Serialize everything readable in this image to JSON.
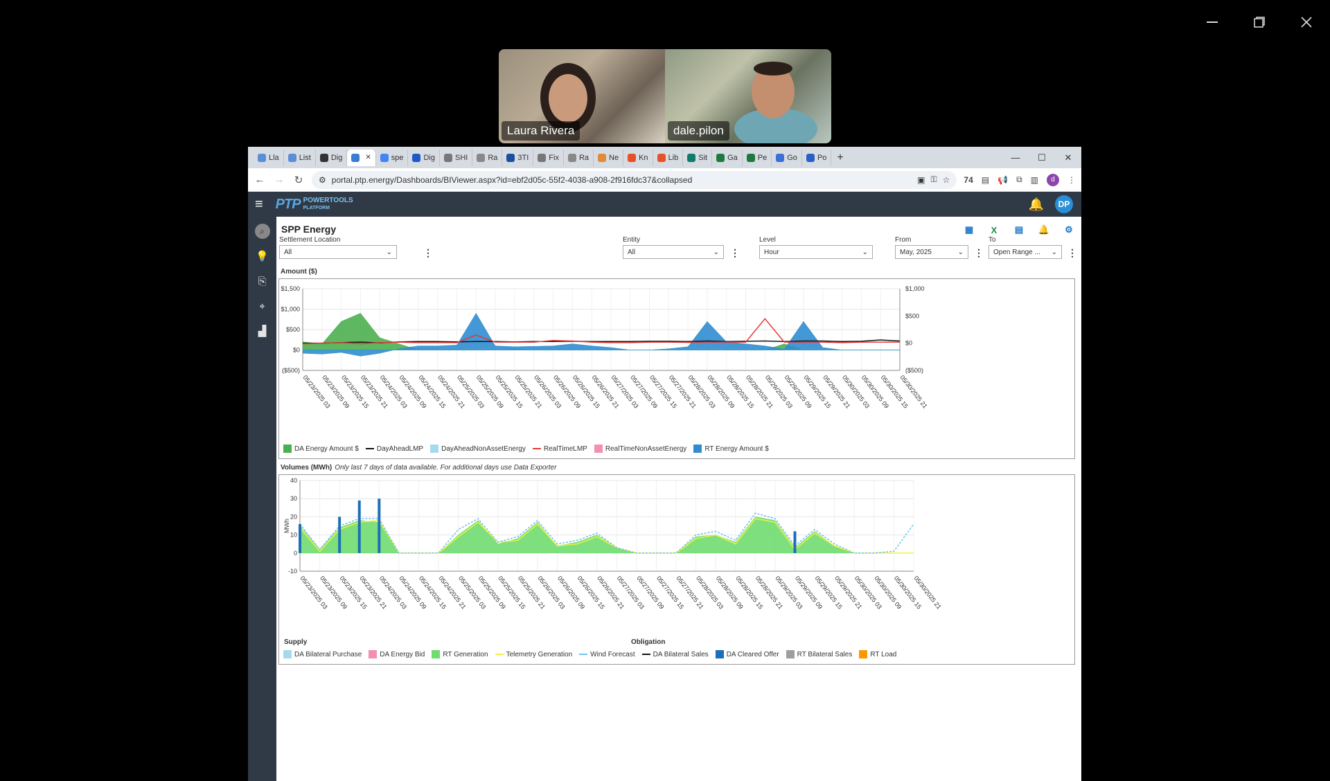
{
  "meeting": {
    "participants": [
      {
        "name": "Laura Rivera"
      },
      {
        "name": "dale.pilon"
      }
    ]
  },
  "browser": {
    "tabs": [
      {
        "label": "Lla",
        "color": "#5a8fd8"
      },
      {
        "label": "List",
        "color": "#5a8fd8"
      },
      {
        "label": "Dig",
        "color": "#333"
      },
      {
        "label": "",
        "color": "#3a7bd5"
      },
      {
        "label": "spe",
        "color": "#4285f4"
      },
      {
        "label": "Dig",
        "color": "#1f57c8"
      },
      {
        "label": "SHI",
        "color": "#777"
      },
      {
        "label": "Ra",
        "color": "#888"
      },
      {
        "label": "3TI",
        "color": "#1a4fa0"
      },
      {
        "label": "Fix",
        "color": "#777"
      },
      {
        "label": "Ra",
        "color": "#888"
      },
      {
        "label": "Ne",
        "color": "#e08a3a"
      },
      {
        "label": "Kn",
        "color": "#e8502a"
      },
      {
        "label": "Lib",
        "color": "#e8502a"
      },
      {
        "label": "Sit",
        "color": "#0f7b6c"
      },
      {
        "label": "Ga",
        "color": "#1d7a3e"
      },
      {
        "label": "Pe",
        "color": "#1d7a3e"
      },
      {
        "label": "Go",
        "color": "#3a6fd8"
      },
      {
        "label": "Po",
        "color": "#2a5fc8"
      }
    ],
    "active_tab_index": 3,
    "url": "portal.ptp.energy/Dashboards/BIViewer.aspx?id=ebf2d05c-55f2-4038-a908-2f916fdc37&collapsed",
    "badge_count": "74",
    "profile_initial": "d"
  },
  "app": {
    "logo_text": "PTP",
    "logo_sub": "POWERTOOLS",
    "logo_sub2": "PLATFORM",
    "user_initials": "DP",
    "page_title": "SPP Energy",
    "filters": {
      "settlement_label": "Settlement Location",
      "settlement_value": "All",
      "entity_label": "Entity",
      "entity_value": "All",
      "level_label": "Level",
      "level_value": "Hour",
      "from_label": "From",
      "from_value": "May, 2025",
      "to_label": "To",
      "to_value": "Open Range ..."
    },
    "amount_section_label": "Amount ($)",
    "volumes_section_label": "Volumes (MWh)",
    "volumes_note": "Only last 7 days of data available. For additional days use Data Exporter",
    "amount_legend": [
      {
        "label": "DA Energy Amount $",
        "color": "#4caf50",
        "kind": "box"
      },
      {
        "label": "DayAheadLMP",
        "color": "#111111",
        "kind": "line"
      },
      {
        "label": "DayAheadNonAssetEnergy",
        "color": "#a6d8f0",
        "kind": "box"
      },
      {
        "label": "RealTimeLMP",
        "color": "#e53935",
        "kind": "line"
      },
      {
        "label": "RealTimeNonAssetEnergy",
        "color": "#f48fb1",
        "kind": "box"
      },
      {
        "label": "RT Energy Amount $",
        "color": "#2f8dd0",
        "kind": "box"
      }
    ],
    "supply_label": "Supply",
    "obligation_label": "Obligation",
    "volume_legend": [
      {
        "label": "DA Bilateral Purchase",
        "color": "#a6d8f0",
        "kind": "box"
      },
      {
        "label": "DA Energy Bid",
        "color": "#f48fb1",
        "kind": "box"
      },
      {
        "label": "RT Generation",
        "color": "#6fdc6f",
        "kind": "box"
      },
      {
        "label": "Telemetry Generation",
        "color": "#f0f040",
        "kind": "line"
      },
      {
        "label": "Wind Forecast",
        "color": "#6cc2f0",
        "kind": "dash"
      },
      {
        "label": "DA Bilateral Sales",
        "color": "#111111",
        "kind": "line"
      },
      {
        "label": "DA Cleared Offer",
        "color": "#1f6fb8",
        "kind": "box"
      },
      {
        "label": "RT Bilateral Sales",
        "color": "#9e9e9e",
        "kind": "box"
      },
      {
        "label": "RT Load",
        "color": "#ff9800",
        "kind": "box"
      }
    ]
  },
  "chart_data": [
    {
      "type": "area",
      "title": "Amount ($)",
      "x": [
        "05/23/2025 03",
        "05/23/2025 09",
        "05/23/2025 15",
        "05/23/2025 21",
        "05/24/2025 03",
        "05/24/2025 09",
        "05/24/2025 15",
        "05/24/2025 21",
        "05/25/2025 03",
        "05/25/2025 09",
        "05/25/2025 15",
        "05/25/2025 21",
        "05/26/2025 03",
        "05/26/2025 09",
        "05/26/2025 15",
        "05/26/2025 21",
        "05/27/2025 03",
        "05/27/2025 09",
        "05/27/2025 15",
        "05/27/2025 21",
        "05/28/2025 03",
        "05/28/2025 09",
        "05/28/2025 15",
        "05/28/2025 21",
        "05/29/2025 03",
        "05/29/2025 09",
        "05/29/2025 15",
        "05/29/2025 21",
        "05/30/2025 03",
        "05/30/2025 09",
        "05/30/2025 15",
        "05/30/2025 21"
      ],
      "y_ticks": [
        "($500)",
        "$0",
        "$500",
        "$1,000",
        "$1,500"
      ],
      "y2_ticks": [
        "($500)",
        "$0",
        "$500",
        "$1,000"
      ],
      "ylim": [
        -500,
        1500
      ],
      "y2lim": [
        -500,
        1000
      ],
      "grid": true,
      "legend_position": "bottom",
      "series": [
        {
          "name": "DA Energy Amount $",
          "axis": "left",
          "values": [
            200,
            150,
            700,
            900,
            300,
            150,
            0,
            0,
            0,
            0,
            0,
            30,
            0,
            0,
            0,
            0,
            0,
            0,
            0,
            0,
            0,
            0,
            0,
            0,
            0,
            150,
            0,
            0,
            0,
            0,
            0,
            0
          ]
        },
        {
          "name": "RT Energy Amount $",
          "axis": "left",
          "values": [
            -80,
            -100,
            -60,
            -150,
            -80,
            30,
            100,
            100,
            120,
            900,
            100,
            80,
            90,
            100,
            150,
            100,
            60,
            0,
            0,
            30,
            80,
            700,
            200,
            150,
            100,
            20,
            700,
            60,
            0,
            0,
            0,
            0
          ]
        },
        {
          "name": "DayAheadLMP",
          "axis": "right",
          "values": [
            0,
            0,
            10,
            20,
            5,
            25,
            30,
            30,
            25,
            30,
            30,
            25,
            30,
            30,
            35,
            30,
            30,
            30,
            35,
            35,
            30,
            40,
            30,
            35,
            40,
            30,
            40,
            40,
            30,
            35,
            60,
            40
          ]
        },
        {
          "name": "RealTimeLMP",
          "axis": "right",
          "values": [
            -10,
            0,
            10,
            -10,
            10,
            20,
            10,
            10,
            10,
            150,
            20,
            20,
            20,
            50,
            40,
            20,
            10,
            10,
            20,
            20,
            15,
            20,
            20,
            20,
            450,
            20,
            20,
            20,
            10,
            20,
            20,
            20
          ]
        }
      ]
    },
    {
      "type": "area",
      "title": "Volumes (MWh)",
      "ylabel": "MWh",
      "x": [
        "05/23/2025 03",
        "05/23/2025 09",
        "05/23/2025 15",
        "05/23/2025 21",
        "05/24/2025 03",
        "05/24/2025 09",
        "05/24/2025 15",
        "05/24/2025 21",
        "05/25/2025 03",
        "05/25/2025 09",
        "05/25/2025 15",
        "05/25/2025 21",
        "05/26/2025 03",
        "05/26/2025 09",
        "05/26/2025 15",
        "05/26/2025 21",
        "05/27/2025 03",
        "05/27/2025 09",
        "05/27/2025 15",
        "05/27/2025 21",
        "05/28/2025 03",
        "05/28/2025 09",
        "05/28/2025 15",
        "05/28/2025 21",
        "05/29/2025 03",
        "05/29/2025 09",
        "05/29/2025 15",
        "05/29/2025 21",
        "05/30/2025 03",
        "05/30/2025 09",
        "05/30/2025 15",
        "05/30/2025 21"
      ],
      "ylim": [
        -10,
        40
      ],
      "y_ticks": [
        "-10",
        "0",
        "10",
        "20",
        "30",
        "40"
      ],
      "grid": true,
      "legend_position": "bottom",
      "series": [
        {
          "name": "RT Generation",
          "values": [
            15,
            2,
            14,
            18,
            17,
            0,
            0,
            0,
            10,
            18,
            5,
            8,
            17,
            4,
            6,
            10,
            3,
            0,
            0,
            0,
            9,
            10,
            6,
            20,
            18,
            3,
            12,
            4,
            0,
            0,
            0,
            0
          ]
        },
        {
          "name": "Telemetry Generation",
          "values": [
            14,
            1,
            13,
            17,
            18,
            0,
            0,
            0,
            9,
            17,
            6,
            7,
            16,
            4,
            5,
            9,
            3,
            0,
            0,
            0,
            8,
            10,
            5,
            19,
            17,
            2,
            11,
            4,
            0,
            0,
            0,
            0
          ]
        },
        {
          "name": "Wind Forecast",
          "values": [
            16,
            2,
            15,
            19,
            19,
            0,
            0,
            0,
            13,
            19,
            6,
            9,
            18,
            5,
            7,
            11,
            3,
            0,
            0,
            0,
            10,
            12,
            7,
            22,
            19,
            4,
            13,
            5,
            0,
            0,
            1,
            16
          ]
        },
        {
          "name": "DA Cleared Offer",
          "values": [
            16,
            0,
            20,
            29,
            30,
            0,
            0,
            0,
            0,
            0,
            0,
            0,
            0,
            0,
            0,
            0,
            0,
            0,
            0,
            0,
            0,
            0,
            0,
            0,
            0,
            12,
            0,
            0,
            0,
            0,
            0,
            0
          ]
        }
      ]
    }
  ]
}
